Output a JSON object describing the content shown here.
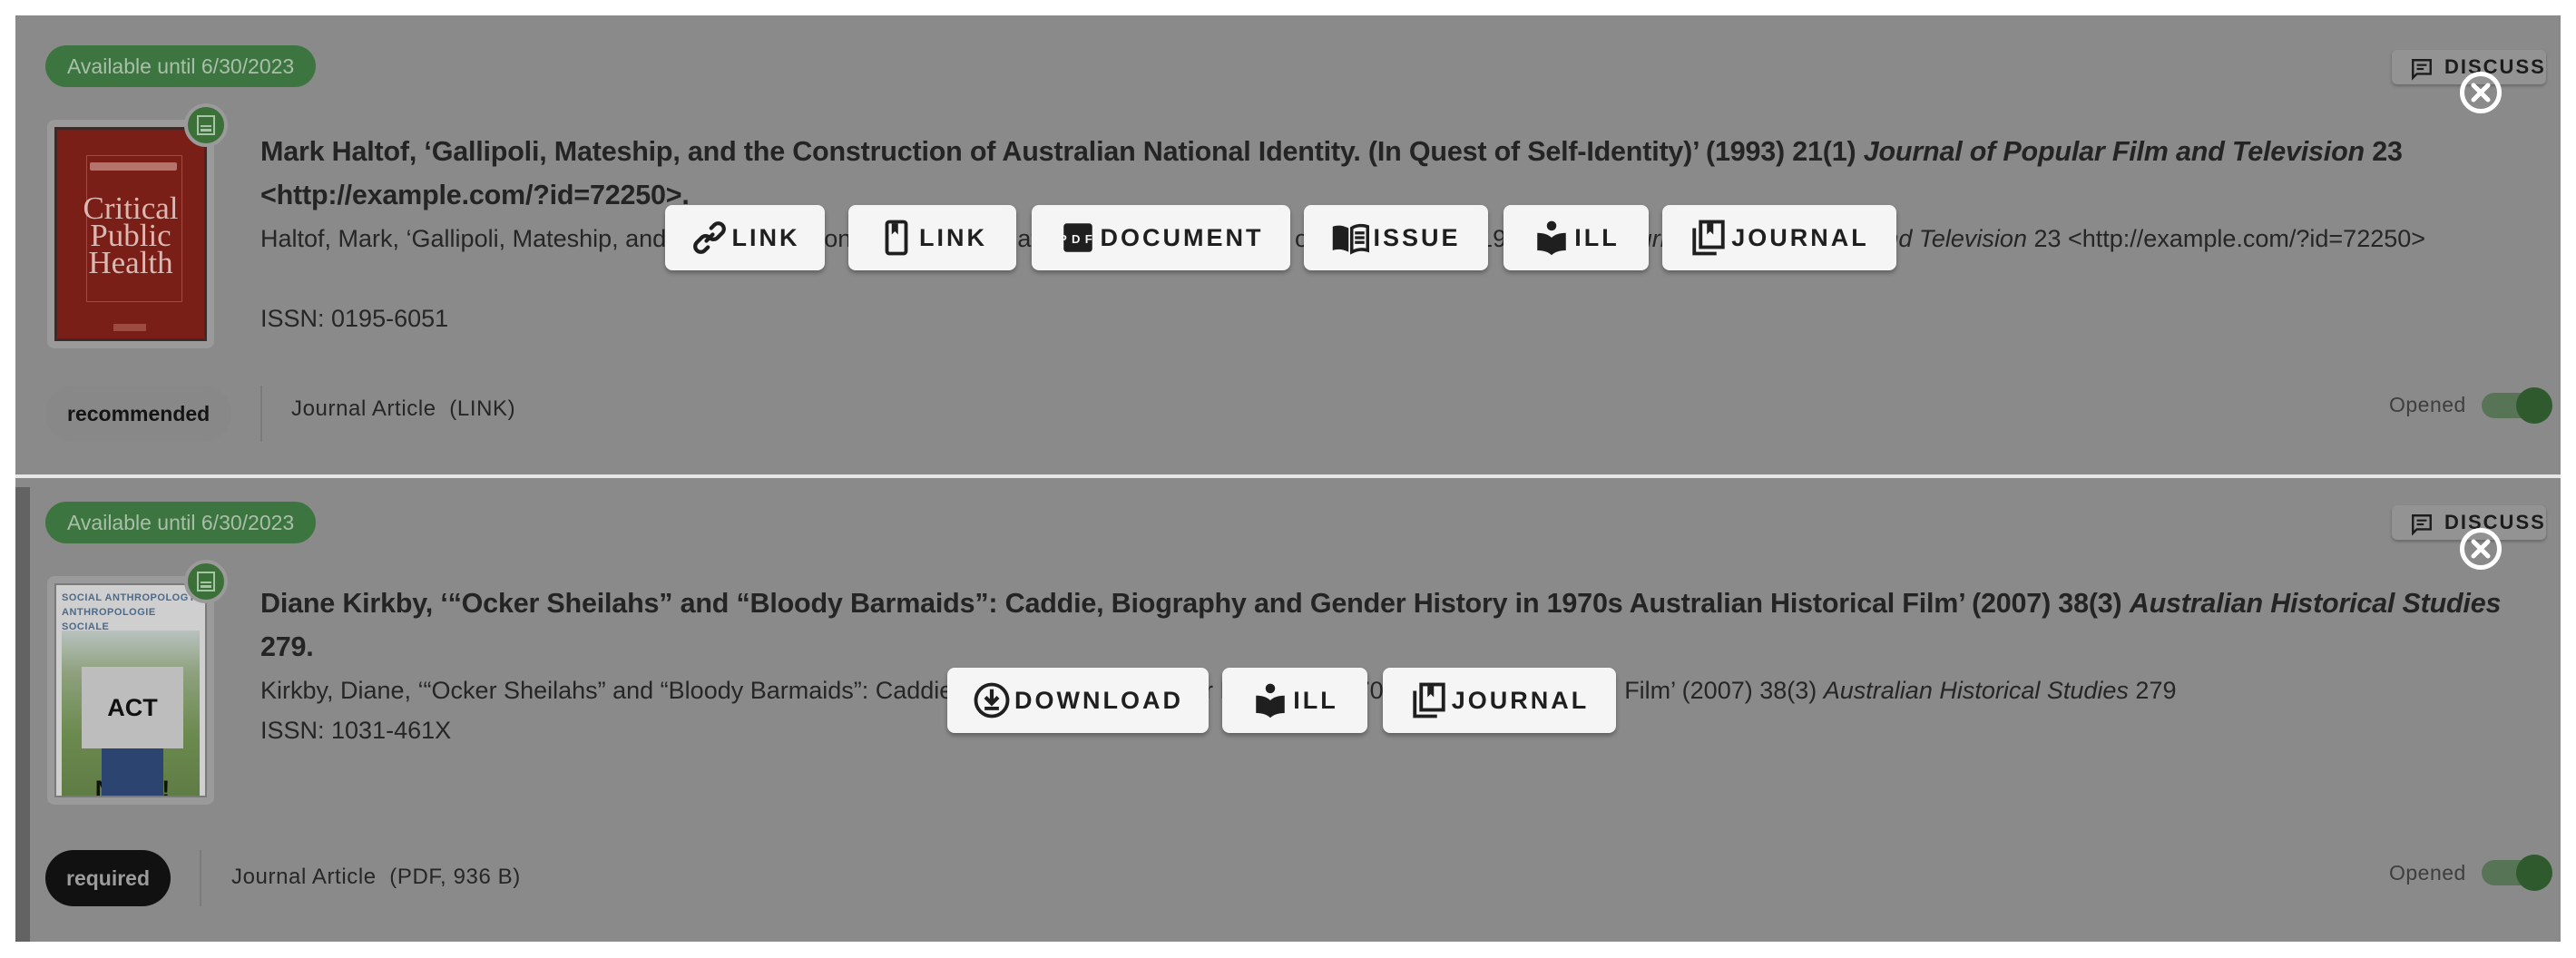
{
  "records": [
    {
      "availability": "Available until 6/30/2023",
      "cover": {
        "title_lines": "Critical Public Health",
        "color": "#7a1f17"
      },
      "title_plain": "Mark Haltof, ‘Gallipoli, Mateship, and the Construction of Australian National Identity. (In Quest of Self-Identity)’ (1993) 21(1) ",
      "title_italic": "Journal of Popular Film and Television",
      "title_tail": " 23 <http://example.com/?id=72250>.",
      "citation_plain": "Haltof, Mark, ‘Gallipoli, Mateship, and the Construction of Australian National Identity. (In Quest of Self-Identity)’ (1993) 21(1) ",
      "citation_italic": "Journal of Popular Film and Television",
      "citation_tail": " 23 <http://example.com/?id=72250>",
      "issn": "ISSN: 0195-6051",
      "importance": "recommended",
      "type": "Journal Article",
      "format": "(LINK)",
      "discuss_label": "DISCUSS",
      "opened_label": "Opened",
      "opened": true,
      "actions": [
        {
          "label": "LINK",
          "icon": "link-icon"
        },
        {
          "label": "LINK",
          "icon": "bookmark-phone-icon"
        },
        {
          "label": "DOCUMENT",
          "icon": "pdf-icon"
        },
        {
          "label": "ISSUE",
          "icon": "open-book-icon"
        },
        {
          "label": "ILL",
          "icon": "reader-icon"
        },
        {
          "label": "JOURNAL",
          "icon": "library-books-icon"
        }
      ]
    },
    {
      "availability": "Available until 6/30/2023",
      "cover": {
        "header_line1": "SOCIAL ANTHROPOLOGY",
        "header_line2": "ANTHROPOLOGIE SOCIALE",
        "sign": "ACT NOW !"
      },
      "title_plain": "Diane Kirkby, ‘“Ocker Sheilahs” and “Bloody Barmaids”: Caddie, Biography and Gender History in 1970s Australian Historical Film’ (2007) 38(3) ",
      "title_italic": "Australian Historical Studies",
      "title_tail": " 279.",
      "citation_plain": "Kirkby, Diane, ‘“Ocker Sheilahs” and “Bloody Barmaids”: Caddie, Biography and Gender History in 1970s Australian Historical Film’ (2007) 38(3) ",
      "citation_italic": "Australian Historical Studies",
      "citation_tail": " 279",
      "issn": "ISSN: 1031-461X",
      "importance": "required",
      "type": "Journal Article",
      "format": "(PDF, 936 B)",
      "discuss_label": "DISCUSS",
      "opened_label": "Opened",
      "opened": true,
      "actions": [
        {
          "label": "DOWNLOAD",
          "icon": "download-icon"
        },
        {
          "label": "ILL",
          "icon": "reader-icon"
        },
        {
          "label": "JOURNAL",
          "icon": "library-books-icon"
        }
      ]
    }
  ],
  "colors": {
    "overlay": "#8a8a8a",
    "available_badge": "#3d7540",
    "toggle_on": "#2f5a2e",
    "action_button_bg": "#f5f5f5"
  }
}
